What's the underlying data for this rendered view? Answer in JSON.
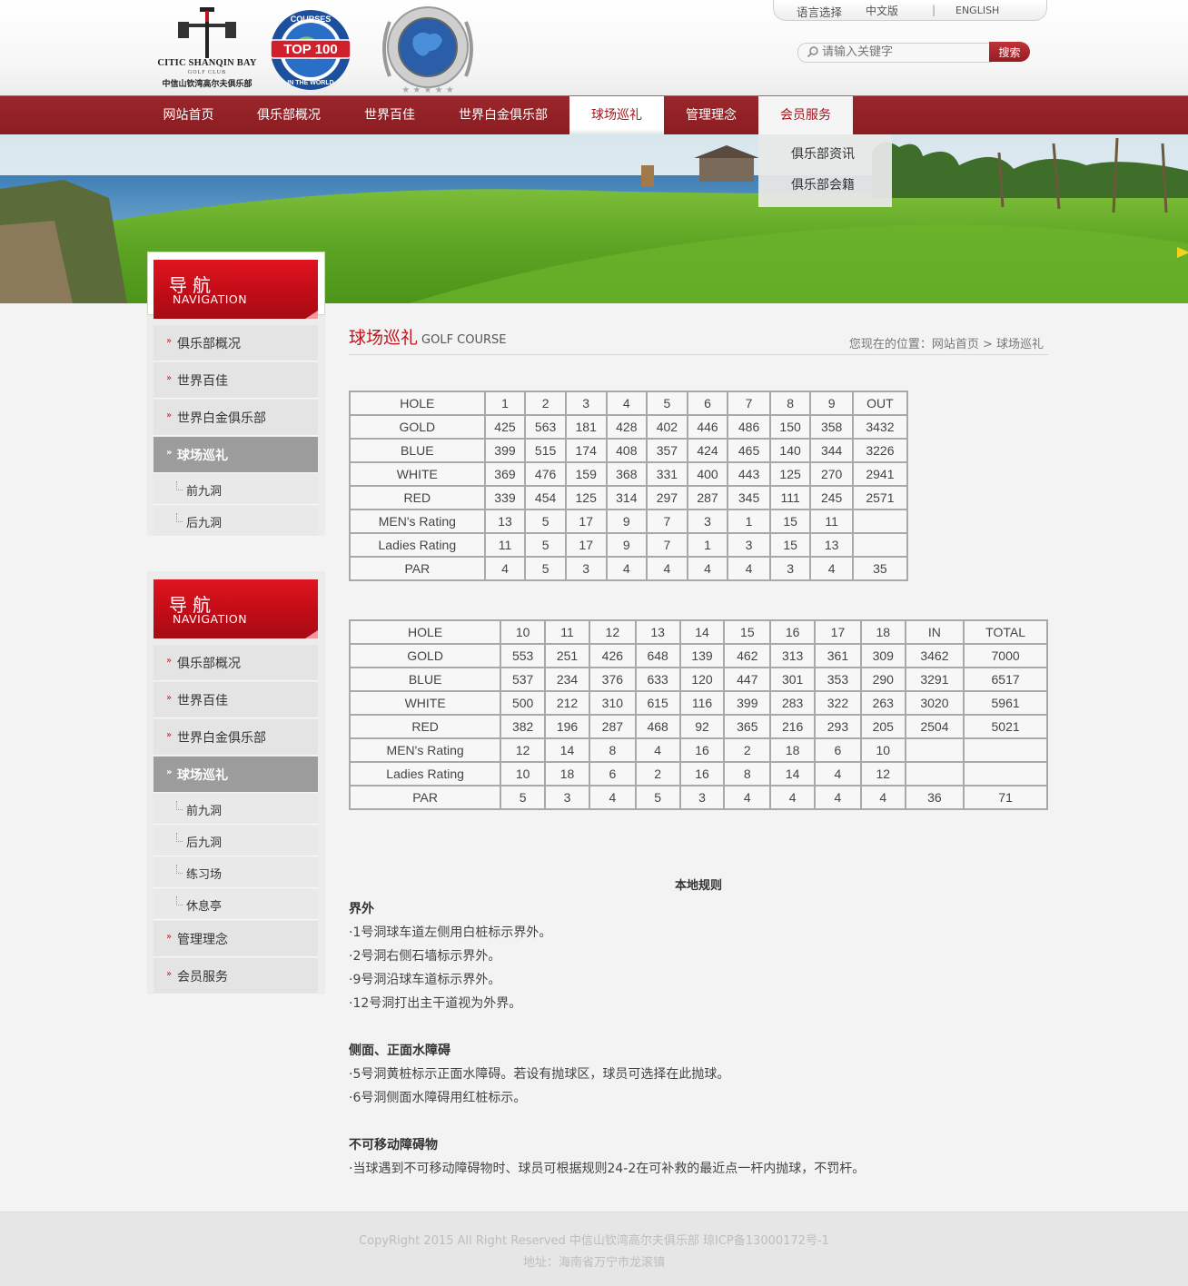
{
  "header": {
    "logo": {
      "name": "CITIC SHANQIN BAY",
      "sub": "GOLF CLUB",
      "cn": "中信山钦湾高尔夫俱乐部"
    },
    "badge1": {
      "top": "COURSES",
      "main": "TOP 100",
      "bottom": "IN THE WORLD"
    },
    "badge2": {
      "ring": "PLATINUM CLUBS OF THE WORLD · 5 STAR PRIVATE CLUB"
    },
    "lang": {
      "label": "语言选择",
      "chinese": "中文版",
      "separator": "|",
      "english": "ENGLISH"
    },
    "search": {
      "placeholder": "请输入关键字",
      "button": "搜索"
    }
  },
  "nav": {
    "items": [
      {
        "label": "网站首页"
      },
      {
        "label": "俱乐部概况"
      },
      {
        "label": "世界百佳"
      },
      {
        "label": "世界白金俱乐部"
      },
      {
        "label": "球场巡礼"
      },
      {
        "label": "管理理念"
      },
      {
        "label": "会员服务"
      }
    ],
    "dropdown": [
      "俱乐部资讯",
      "俱乐部会籍"
    ]
  },
  "sidebar1": {
    "title": "导航",
    "subtitle": "NAVIGATION",
    "items": [
      "俱乐部概况",
      "世界百佳",
      "世界白金俱乐部",
      "球场巡礼"
    ],
    "subitems": [
      "前九洞",
      "后九洞"
    ]
  },
  "sidebar2": {
    "title": "导航",
    "subtitle": "NAVIGATION",
    "items": [
      "俱乐部概况",
      "世界百佳",
      "世界白金俱乐部",
      "球场巡礼"
    ],
    "subitems": [
      "前九洞",
      "后九洞",
      "练习场",
      "休息亭"
    ],
    "items_after": [
      "管理理念",
      "会员服务"
    ]
  },
  "page": {
    "title_cn": "球场巡礼",
    "title_en": "GOLF COURSE",
    "breadcrumb": "您现在的位置：网站首页 > 球场巡礼"
  },
  "front_nine": {
    "header": [
      "HOLE",
      "1",
      "2",
      "3",
      "4",
      "5",
      "6",
      "7",
      "8",
      "9",
      "OUT"
    ],
    "rows": [
      [
        "GOLD",
        "425",
        "563",
        "181",
        "428",
        "402",
        "446",
        "486",
        "150",
        "358",
        "3432"
      ],
      [
        "BLUE",
        "399",
        "515",
        "174",
        "408",
        "357",
        "424",
        "465",
        "140",
        "344",
        "3226"
      ],
      [
        "WHITE",
        "369",
        "476",
        "159",
        "368",
        "331",
        "400",
        "443",
        "125",
        "270",
        "2941"
      ],
      [
        "RED",
        "339",
        "454",
        "125",
        "314",
        "297",
        "287",
        "345",
        "111",
        "245",
        "2571"
      ],
      [
        "MEN's Rating",
        "13",
        "5",
        "17",
        "9",
        "7",
        "3",
        "1",
        "15",
        "11",
        ""
      ],
      [
        "Ladies Rating",
        "11",
        "5",
        "17",
        "9",
        "7",
        "1",
        "3",
        "15",
        "13",
        ""
      ],
      [
        "PAR",
        "4",
        "5",
        "3",
        "4",
        "4",
        "4",
        "4",
        "3",
        "4",
        "35"
      ]
    ]
  },
  "back_nine": {
    "header": [
      "HOLE",
      "10",
      "11",
      "12",
      "13",
      "14",
      "15",
      "16",
      "17",
      "18",
      "IN",
      "TOTAL"
    ],
    "rows": [
      [
        "GOLD",
        "553",
        "251",
        "426",
        "648",
        "139",
        "462",
        "313",
        "361",
        "309",
        "3462",
        "7000"
      ],
      [
        "BLUE",
        "537",
        "234",
        "376",
        "633",
        "120",
        "447",
        "301",
        "353",
        "290",
        "3291",
        "6517"
      ],
      [
        "WHITE",
        "500",
        "212",
        "310",
        "615",
        "116",
        "399",
        "283",
        "322",
        "263",
        "3020",
        "5961"
      ],
      [
        "RED",
        "382",
        "196",
        "287",
        "468",
        "92",
        "365",
        "216",
        "293",
        "205",
        "2504",
        "5021"
      ],
      [
        "MEN's Rating",
        "12",
        "14",
        "8",
        "4",
        "16",
        "2",
        "18",
        "6",
        "10",
        "",
        ""
      ],
      [
        "Ladies Rating",
        "10",
        "18",
        "6",
        "2",
        "16",
        "8",
        "14",
        "4",
        "12",
        "",
        ""
      ],
      [
        "PAR",
        "5",
        "3",
        "4",
        "5",
        "3",
        "4",
        "4",
        "4",
        "4",
        "36",
        "71"
      ]
    ]
  },
  "rules": {
    "heading": "本地规则",
    "sections": [
      {
        "title": "界外",
        "lines": [
          "·1号洞球车道左侧用白桩标示界外。",
          "·2号洞右侧石墙标示界外。",
          "·9号洞沿球车道标示界外。",
          "·12号洞打出主干道视为外界。"
        ]
      },
      {
        "title": "侧面、正面水障碍",
        "lines": [
          "·5号洞黄桩标示正面水障碍。若设有抛球区，球员可选择在此抛球。",
          "·6号洞侧面水障碍用红桩标示。"
        ]
      },
      {
        "title": "不可移动障碍物",
        "lines": [
          "·当球遇到不可移动障碍物时、球员可根据规则24-2在可补救的最近点一杆内抛球，不罚杆。"
        ]
      }
    ]
  },
  "footer": {
    "copyright": "CopyRight 2015 All Right Reserved 中信山钦湾高尔夫俱乐部 琼ICP备13000172号-1",
    "address": "地址：海南省万宁市龙滚镇"
  },
  "colors": {
    "brand_red": "#9a262b",
    "accent_red": "#c0151d",
    "sidebar_active": "#9c9c9c"
  }
}
